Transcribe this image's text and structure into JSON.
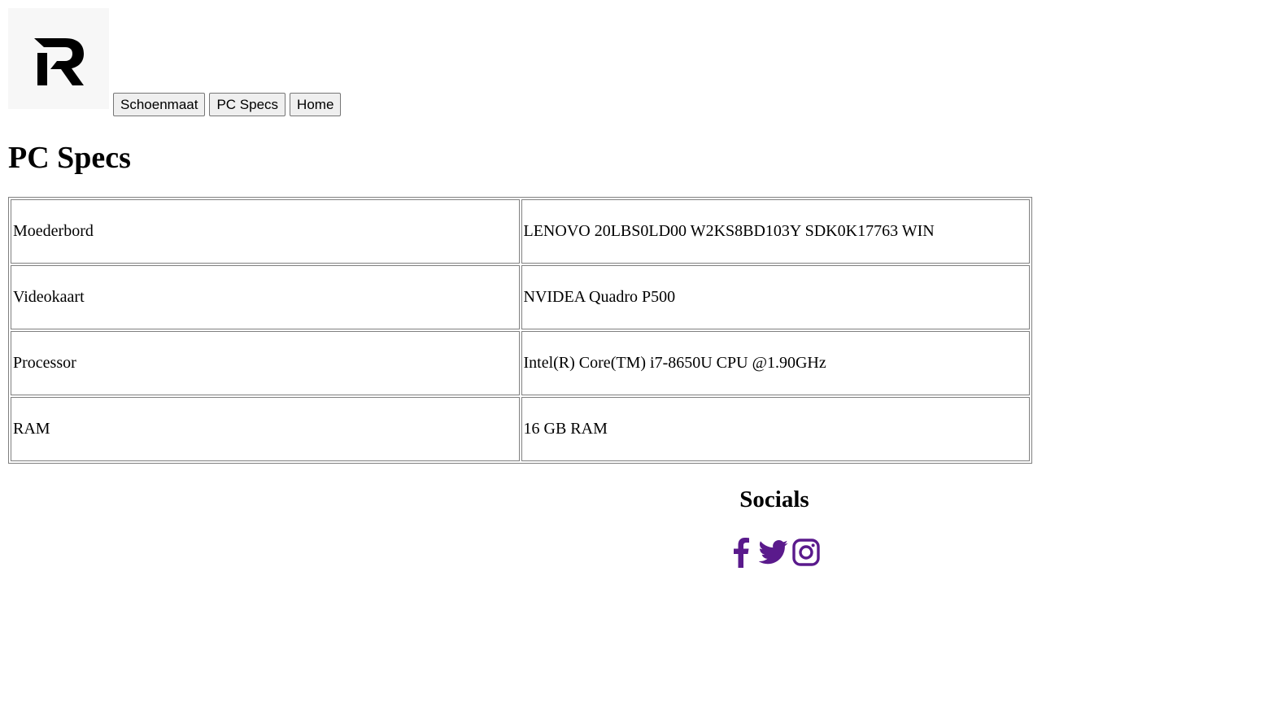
{
  "header": {
    "logo_icon": "r-logo-icon",
    "nav": [
      {
        "label": "Schoenmaat"
      },
      {
        "label": "PC Specs"
      },
      {
        "label": "Home"
      }
    ]
  },
  "main": {
    "title": "PC Specs",
    "specs": [
      {
        "label": "Moederbord",
        "value": "LENOVO 20LBS0LD00 W2KS8BD103Y SDK0K17763 WIN"
      },
      {
        "label": "Videokaart",
        "value": "NVIDEA Quadro P500"
      },
      {
        "label": "Processor",
        "value": "Intel(R) Core(TM) i7-8650U CPU @1.90GHz"
      },
      {
        "label": "RAM",
        "value": "16 GB RAM"
      }
    ]
  },
  "socials": {
    "title": "Socials",
    "icon_color": "#5a1a8c",
    "icons": [
      "facebook-icon",
      "twitter-icon",
      "instagram-icon"
    ]
  }
}
